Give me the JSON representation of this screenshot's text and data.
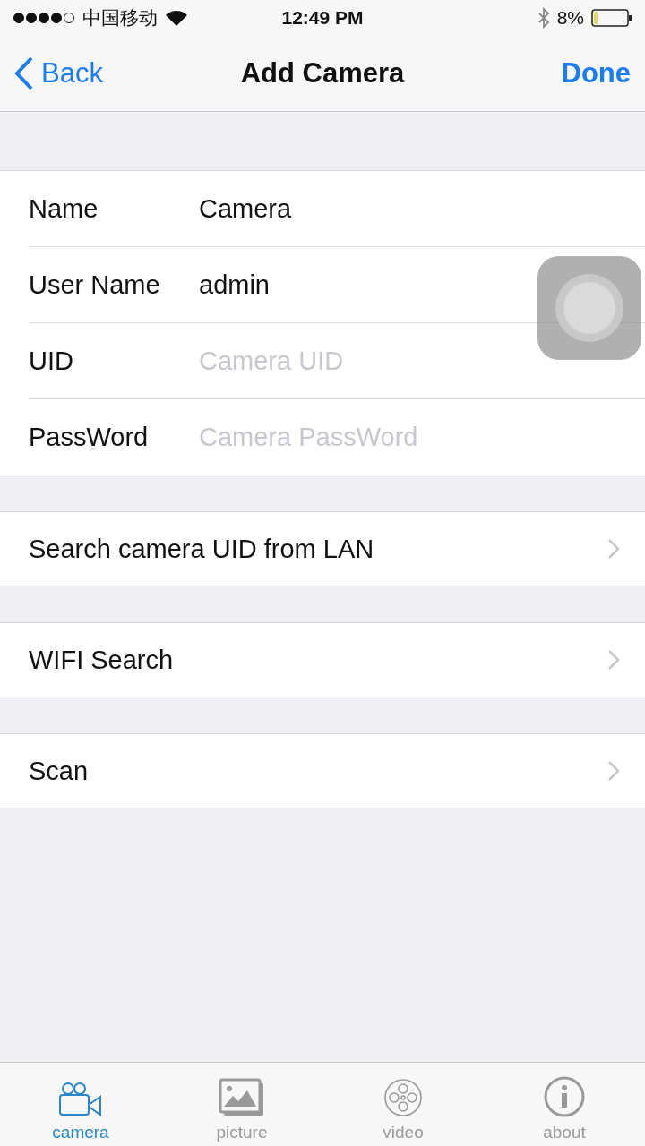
{
  "status_bar": {
    "carrier": "中国移动",
    "time": "12:49 PM",
    "battery": "8%"
  },
  "nav": {
    "back": "Back",
    "title": "Add Camera",
    "done": "Done"
  },
  "fields": [
    {
      "label": "Name",
      "value": "Camera"
    },
    {
      "label": "User Name",
      "value": "admin"
    },
    {
      "label": "UID",
      "placeholder": "Camera UID"
    },
    {
      "label": "PassWord",
      "placeholder": "Camera PassWord"
    }
  ],
  "actions": [
    {
      "label": "Search camera UID from LAN"
    },
    {
      "label": "WIFI Search"
    },
    {
      "label": "Scan"
    }
  ],
  "tabs": [
    {
      "label": "camera",
      "kind": "camera",
      "selected": true
    },
    {
      "label": "picture",
      "kind": "picture",
      "selected": false
    },
    {
      "label": "video",
      "kind": "video",
      "selected": false
    },
    {
      "label": "about",
      "kind": "about",
      "selected": false
    }
  ]
}
